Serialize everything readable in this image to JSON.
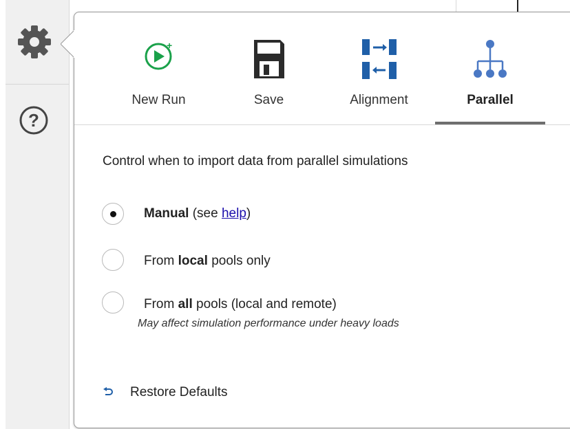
{
  "rail": {
    "settings_icon": "gear-icon",
    "help_icon": "question-circle-icon"
  },
  "toolbar": {
    "items": [
      {
        "label": "New Run",
        "icon": "new-run-play-plus-icon"
      },
      {
        "label": "Save",
        "icon": "floppy-disk-icon"
      },
      {
        "label": "Alignment",
        "icon": "alignment-arrows-icon"
      },
      {
        "label": "Parallel",
        "icon": "parallel-tree-icon",
        "active": true
      }
    ]
  },
  "panel": {
    "description": "Control when to import data from parallel simulations",
    "options": [
      {
        "prefix": "",
        "bold": "Manual",
        "suffix_before_link": " (see ",
        "link": "help",
        "suffix_after_link": ")",
        "checked": true
      },
      {
        "prefix": "From ",
        "bold": "local",
        "suffix": " pools only",
        "checked": false
      },
      {
        "prefix": "From ",
        "bold": "all",
        "suffix": " pools (local and remote)",
        "note": "May affect simulation performance under heavy loads",
        "checked": false
      }
    ],
    "restore_label": "Restore Defaults"
  },
  "colors": {
    "accent_green": "#1aa14a",
    "icon_dark": "#2b2b2b",
    "icon_blue": "#1f5fa8",
    "tree_blue": "#4a78c4",
    "link_blue": "#1a0dab"
  }
}
